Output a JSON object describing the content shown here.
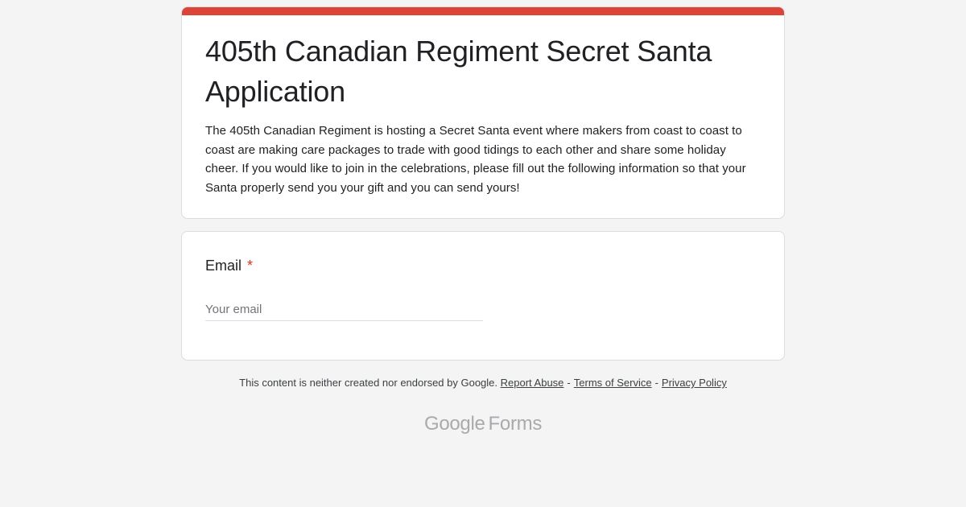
{
  "form": {
    "title": "405th Canadian Regiment Secret Santa Application",
    "description": "The 405th Canadian Regiment is hosting a Secret Santa event where makers from coast to coast to coast are making care packages to trade with good tidings to each other and share some holiday cheer. If you would like to join in the celebrations, please fill out the following information so that your Santa properly send you your gift and you can send yours!",
    "accent_color": "#db4437"
  },
  "question": {
    "label": "Email",
    "required_mark": "*",
    "placeholder": "Your email",
    "value": ""
  },
  "footer": {
    "disclaimer": "This content is neither created nor endorsed by Google.",
    "report_abuse": "Report Abuse",
    "terms": "Terms of Service",
    "privacy": "Privacy Policy",
    "separator": "-"
  },
  "brand": {
    "google": "Google",
    "forms": "Forms"
  }
}
